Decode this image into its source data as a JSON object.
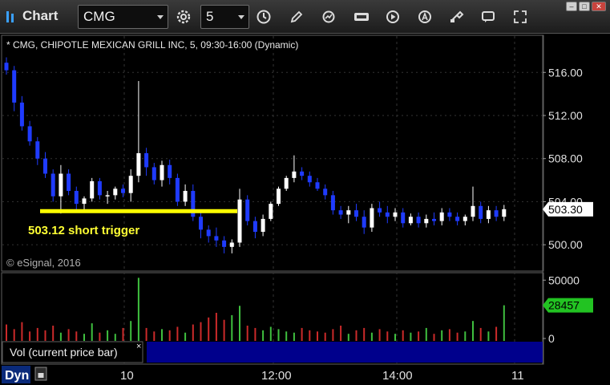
{
  "toolbar": {
    "title": "Chart",
    "symbol": "CMG",
    "interval": "5"
  },
  "chart_info": "* CMG, CHIPOTLE MEXICAN GRILL INC, 5, 09:30-16:00 (Dynamic)",
  "copyright": "© eSignal, 2016",
  "annotation": {
    "text": "503.12 short trigger",
    "price": 503.12,
    "color": "#ffff00"
  },
  "price_axis": {
    "ticks": [
      "516.00",
      "512.00",
      "508.00",
      "504.00",
      "500.00"
    ],
    "last_price": "503.30"
  },
  "volume_axis": {
    "ticks": [
      "50000",
      "0"
    ],
    "last_volume": "28457"
  },
  "time_axis": {
    "ticks": [
      "10",
      "12:00",
      "14:00",
      "11"
    ]
  },
  "volume_panel": {
    "label": "Vol (current price bar)",
    "close_symbol": "×"
  },
  "status": {
    "mode": "Dyn"
  },
  "colors": {
    "up": "#ffffff",
    "down": "#1f3bff",
    "vol_up": "#3fbf3f",
    "vol_down": "#cc2a2a",
    "last_price_bg": "#ffffff",
    "last_volume_bg": "#22c322"
  },
  "chart_data": {
    "type": "candlestick",
    "price_ylim": [
      498.0,
      519.0
    ],
    "volume_ylim": [
      0,
      55000
    ],
    "candles": [
      [
        516.9,
        517.4,
        515.8,
        516.2
      ],
      [
        516.2,
        516.6,
        512.4,
        513.2
      ],
      [
        513.2,
        513.8,
        510.6,
        511.0
      ],
      [
        511.0,
        511.5,
        509.2,
        509.6
      ],
      [
        509.6,
        510.0,
        507.4,
        508.0
      ],
      [
        508.0,
        508.6,
        506.2,
        506.6
      ],
      [
        506.6,
        507.0,
        504.0,
        504.5
      ],
      [
        504.5,
        507.4,
        502.9,
        506.6
      ],
      [
        506.6,
        507.0,
        504.6,
        505.0
      ],
      [
        505.0,
        505.4,
        503.2,
        503.8
      ],
      [
        503.8,
        504.5,
        503.0,
        504.3
      ],
      [
        504.3,
        506.2,
        504.0,
        505.9
      ],
      [
        505.9,
        506.2,
        504.2,
        504.6
      ],
      [
        504.6,
        505.0,
        503.8,
        504.6
      ],
      [
        504.6,
        505.4,
        504.2,
        505.2
      ],
      [
        505.2,
        505.6,
        504.4,
        504.8
      ],
      [
        504.8,
        507.0,
        504.0,
        506.4
      ],
      [
        506.4,
        515.2,
        505.8,
        508.5
      ],
      [
        508.5,
        509.0,
        506.4,
        507.2
      ],
      [
        507.2,
        507.6,
        505.6,
        506.0
      ],
      [
        506.0,
        507.8,
        505.4,
        507.4
      ],
      [
        507.4,
        507.9,
        505.6,
        506.2
      ],
      [
        506.2,
        506.6,
        503.6,
        504.0
      ],
      [
        504.0,
        505.6,
        503.6,
        505.0
      ],
      [
        505.0,
        505.6,
        502.2,
        502.6
      ],
      [
        502.6,
        503.0,
        500.6,
        501.4
      ],
      [
        501.4,
        501.8,
        500.2,
        500.8
      ],
      [
        500.8,
        501.6,
        499.8,
        500.4
      ],
      [
        500.4,
        500.8,
        499.2,
        499.8
      ],
      [
        499.8,
        500.5,
        499.2,
        500.2
      ],
      [
        500.2,
        505.2,
        499.8,
        504.2
      ],
      [
        504.2,
        504.6,
        501.8,
        502.2
      ],
      [
        502.2,
        502.6,
        500.6,
        501.2
      ],
      [
        501.2,
        502.8,
        500.8,
        502.4
      ],
      [
        502.4,
        504.0,
        502.2,
        503.8
      ],
      [
        503.8,
        505.4,
        503.6,
        505.2
      ],
      [
        505.2,
        506.4,
        505.0,
        506.2
      ],
      [
        506.2,
        508.3,
        505.8,
        506.8
      ],
      [
        506.8,
        507.2,
        506.0,
        506.4
      ],
      [
        506.4,
        506.8,
        505.4,
        505.8
      ],
      [
        505.8,
        506.2,
        505.0,
        505.2
      ],
      [
        505.2,
        505.6,
        504.2,
        504.6
      ],
      [
        504.6,
        505.0,
        502.8,
        503.2
      ],
      [
        503.2,
        503.6,
        502.4,
        502.8
      ],
      [
        502.8,
        503.6,
        502.0,
        503.2
      ],
      [
        503.2,
        503.8,
        502.2,
        502.6
      ],
      [
        502.6,
        503.2,
        501.0,
        501.6
      ],
      [
        501.6,
        503.8,
        501.2,
        503.4
      ],
      [
        503.4,
        504.0,
        502.6,
        503.0
      ],
      [
        503.0,
        503.6,
        502.0,
        502.6
      ],
      [
        502.6,
        503.4,
        502.2,
        503.0
      ],
      [
        503.0,
        503.4,
        501.6,
        502.0
      ],
      [
        502.0,
        502.9,
        501.8,
        502.6
      ],
      [
        502.6,
        503.0,
        501.6,
        502.0
      ],
      [
        502.0,
        502.8,
        501.6,
        502.4
      ],
      [
        502.4,
        503.0,
        501.8,
        502.2
      ],
      [
        502.2,
        503.4,
        501.8,
        503.0
      ],
      [
        503.0,
        503.4,
        502.2,
        502.6
      ],
      [
        502.6,
        503.0,
        501.8,
        502.2
      ],
      [
        502.2,
        502.8,
        501.8,
        502.6
      ],
      [
        502.6,
        505.4,
        502.2,
        503.6
      ],
      [
        503.6,
        504.0,
        502.0,
        502.4
      ],
      [
        502.4,
        503.6,
        502.0,
        503.2
      ],
      [
        503.2,
        503.6,
        502.2,
        502.6
      ],
      [
        502.6,
        503.7,
        502.2,
        503.3
      ]
    ],
    "volumes": [
      12000,
      8000,
      14000,
      6000,
      9000,
      7000,
      11000,
      5000,
      8000,
      6000,
      4000,
      13000,
      5000,
      7000,
      4000,
      9000,
      15000,
      52000,
      9000,
      6000,
      8000,
      7000,
      10000,
      5000,
      12000,
      14000,
      18000,
      22000,
      16000,
      20000,
      28000,
      11000,
      9000,
      7000,
      10000,
      8000,
      6000,
      5000,
      9000,
      7000,
      6000,
      5000,
      8000,
      11000,
      4000,
      7000,
      9000,
      5000,
      8000,
      6000,
      4000,
      7000,
      5000,
      6000,
      9000,
      4000,
      7000,
      8000,
      5000,
      6000,
      15000,
      9000,
      6000,
      10000,
      28457
    ]
  }
}
